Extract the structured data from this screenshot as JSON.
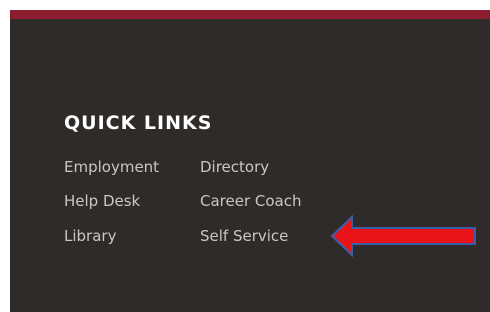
{
  "footer": {
    "heading": "QUICK LINKS",
    "links": [
      {
        "label": "Employment"
      },
      {
        "label": "Directory"
      },
      {
        "label": "Help Desk"
      },
      {
        "label": "Career Coach"
      },
      {
        "label": "Library"
      },
      {
        "label": "Self Service"
      }
    ]
  },
  "colors": {
    "accent_bar": "#8a1e2e",
    "panel_background": "#2f2b29",
    "heading_text": "#ffffff",
    "link_text": "#c9c7c4",
    "annotation_arrow_fill": "#e8141a",
    "annotation_arrow_outline": "#3a5fa8"
  },
  "annotation": {
    "icon": "left-arrow-icon",
    "points_to": "Self Service"
  }
}
